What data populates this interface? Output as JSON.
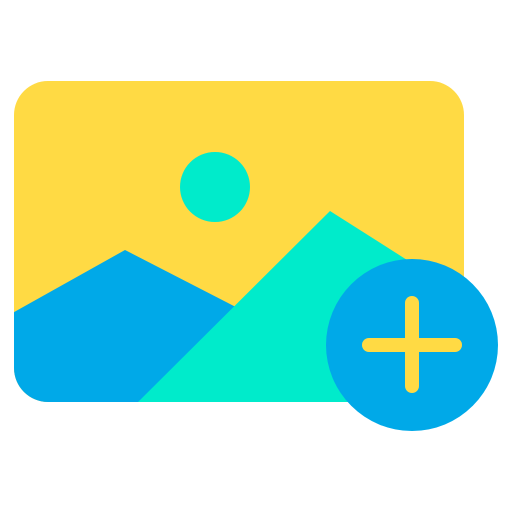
{
  "icon": {
    "name": "add-image-icon",
    "parts": {
      "photo": "image-icon",
      "sun": "sun-icon",
      "mountains": "mountain-icon",
      "badge": "plus-icon"
    }
  },
  "colors": {
    "frame": "#FFDA44",
    "sun": "#00EBCB",
    "back_mountain": "#00A9E8",
    "front_mountain": "#00EBCB",
    "badge_fill": "#00A9E8",
    "plus_stroke": "#FFDA44",
    "background": "#FFFFFF"
  }
}
